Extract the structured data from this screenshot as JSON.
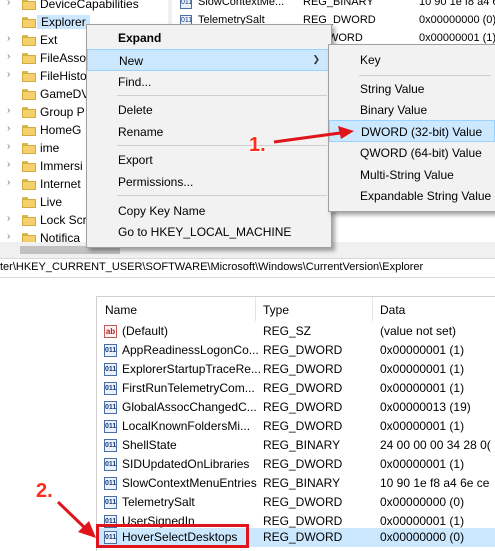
{
  "tree": {
    "items": [
      {
        "label": "DeviceCapabilities"
      },
      {
        "label": "Explorer"
      },
      {
        "label": "Ext"
      },
      {
        "label": "FileAsso"
      },
      {
        "label": "FileHisto"
      },
      {
        "label": "GameDV"
      },
      {
        "label": "Group P"
      },
      {
        "label": "HomeG"
      },
      {
        "label": "ime"
      },
      {
        "label": "Immersi"
      },
      {
        "label": "Internet"
      },
      {
        "label": "Live"
      },
      {
        "label": "Lock Scr"
      },
      {
        "label": "Notifica"
      }
    ]
  },
  "top_values": [
    {
      "name": "SlowContextMe...",
      "type": "REG_BINARY",
      "data": "10 90 1e f8 a4 6"
    },
    {
      "name": "TelemetrySalt",
      "type": "REG_DWORD",
      "data": "0x00000000 (0)"
    },
    {
      "name": "",
      "type": "DWORD",
      "data": "0x00000001 (1)"
    }
  ],
  "context_menu": {
    "items": [
      "Expand",
      "New",
      "Find...",
      "Delete",
      "Rename",
      "Export",
      "Permissions...",
      "Copy Key Name",
      "Go to HKEY_LOCAL_MACHINE"
    ]
  },
  "submenu": {
    "items": [
      "Key",
      "String Value",
      "Binary Value",
      "DWORD (32-bit) Value",
      "QWORD (64-bit) Value",
      "Multi-String Value",
      "Expandable String Value"
    ]
  },
  "annotations": {
    "step1": "1.",
    "step2": "2."
  },
  "address_bar": {
    "path": "ter\\HKEY_CURRENT_USER\\SOFTWARE\\Microsoft\\Windows\\CurrentVersion\\Explorer"
  },
  "table": {
    "headers": {
      "name": "Name",
      "type": "Type",
      "data": "Data"
    },
    "rows": [
      {
        "icon": "ab",
        "name": "(Default)",
        "type": "REG_SZ",
        "data": "(value not set)"
      },
      {
        "icon": "bin",
        "name": "AppReadinessLogonCo...",
        "type": "REG_DWORD",
        "data": "0x00000001 (1)"
      },
      {
        "icon": "bin",
        "name": "ExplorerStartupTraceRe...",
        "type": "REG_DWORD",
        "data": "0x00000001 (1)"
      },
      {
        "icon": "bin",
        "name": "FirstRunTelemetryCom...",
        "type": "REG_DWORD",
        "data": "0x00000001 (1)"
      },
      {
        "icon": "bin",
        "name": "GlobalAssocChangedC...",
        "type": "REG_DWORD",
        "data": "0x00000013 (19)"
      },
      {
        "icon": "bin",
        "name": "LocalKnownFoldersMi...",
        "type": "REG_DWORD",
        "data": "0x00000001 (1)"
      },
      {
        "icon": "bin",
        "name": "ShellState",
        "type": "REG_BINARY",
        "data": "24 00 00 00 34 28 0("
      },
      {
        "icon": "bin",
        "name": "SIDUpdatedOnLibraries",
        "type": "REG_DWORD",
        "data": "0x00000001 (1)"
      },
      {
        "icon": "bin",
        "name": "SlowContextMenuEntries",
        "type": "REG_BINARY",
        "data": "10 90 1e f8 a4 6e ce"
      },
      {
        "icon": "bin",
        "name": "TelemetrySalt",
        "type": "REG_DWORD",
        "data": "0x00000000 (0)"
      },
      {
        "icon": "bin",
        "name": "UserSignedIn",
        "type": "REG_DWORD",
        "data": "0x00000001 (1)"
      },
      {
        "icon": "bin",
        "name": "HoverSelectDesktops",
        "type": "REG_DWORD",
        "data": "0x00000000 (0)"
      }
    ]
  },
  "icons": {
    "binary_value_glyph": "011",
    "string_value_glyph": "ab"
  },
  "colors": {
    "selection": "#cce8ff",
    "annotation_red": "#e0141b",
    "folder": "#f3d06a"
  }
}
